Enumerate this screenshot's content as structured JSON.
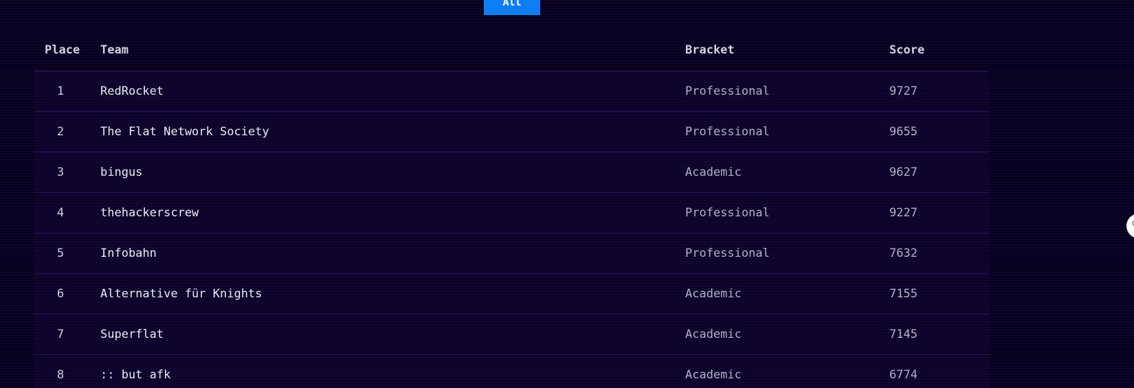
{
  "filter": {
    "active_tab_label": "All"
  },
  "table": {
    "headers": {
      "place": "Place",
      "team": "Team",
      "bracket": "Bracket",
      "score": "Score"
    },
    "rows": [
      {
        "place": "1",
        "team": "RedRocket",
        "bracket": "Professional",
        "score": "9727"
      },
      {
        "place": "2",
        "team": "The Flat Network Society",
        "bracket": "Professional",
        "score": "9655"
      },
      {
        "place": "3",
        "team": "bingus",
        "bracket": "Academic",
        "score": "9627"
      },
      {
        "place": "4",
        "team": "thehackerscrew",
        "bracket": "Professional",
        "score": "9227"
      },
      {
        "place": "5",
        "team": "Infobahn",
        "bracket": "Professional",
        "score": "7632"
      },
      {
        "place": "6",
        "team": "Alternative für Knights",
        "bracket": "Academic",
        "score": "7155"
      },
      {
        "place": "7",
        "team": "Superflat",
        "bracket": "Academic",
        "score": "7145"
      },
      {
        "place": "8",
        "team": ":: but afk",
        "bracket": "Academic",
        "score": "6774"
      }
    ]
  },
  "colors": {
    "background": "#07001a",
    "accent": "#0d7ff2",
    "row_divider": "#261560"
  },
  "icons": {
    "side_handle": "circle-handle-icon"
  }
}
